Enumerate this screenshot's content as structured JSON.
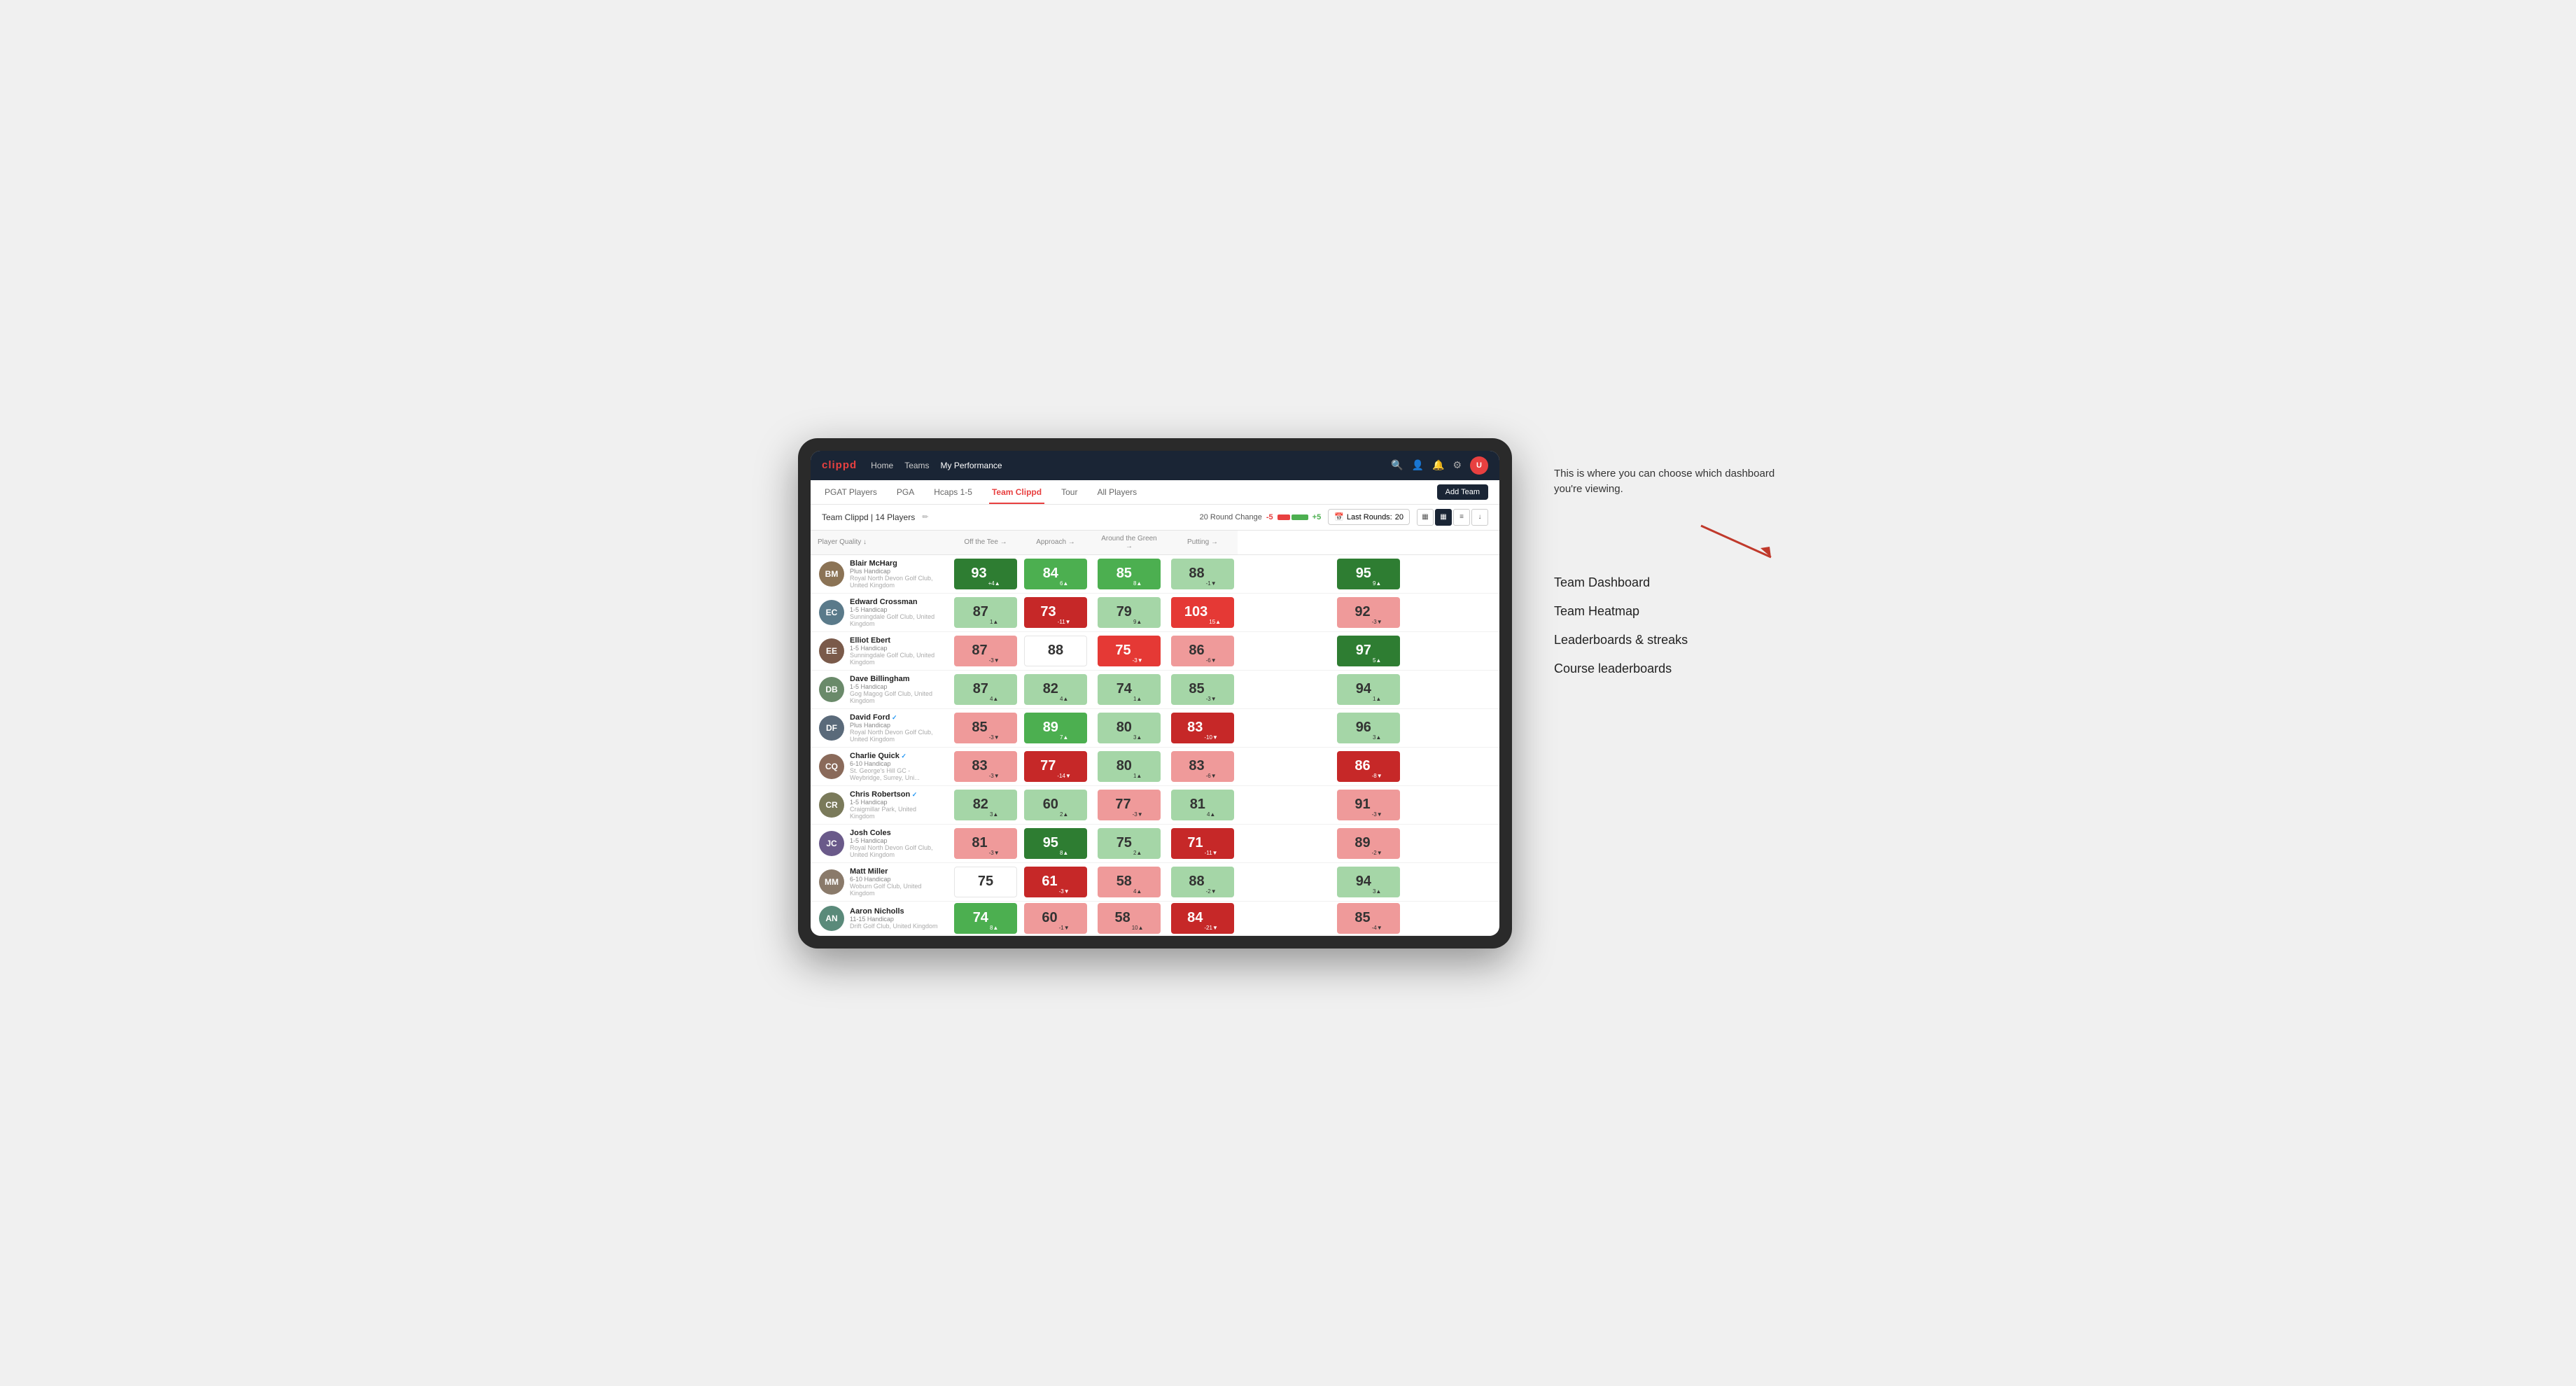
{
  "annotation": {
    "text": "This is where you can choose which dashboard you're viewing.",
    "arrow": "→"
  },
  "dashboard_options": [
    "Team Dashboard",
    "Team Heatmap",
    "Leaderboards & streaks",
    "Course leaderboards"
  ],
  "nav": {
    "logo": "clippd",
    "links": [
      "Home",
      "Teams",
      "My Performance"
    ],
    "active_link": "My Performance"
  },
  "tabs": [
    {
      "label": "PGAT Players"
    },
    {
      "label": "PGA"
    },
    {
      "label": "Hcaps 1-5"
    },
    {
      "label": "Team Clippd",
      "active": true
    },
    {
      "label": "Tour"
    },
    {
      "label": "All Players"
    }
  ],
  "add_team_label": "Add Team",
  "toolbar": {
    "team_label": "Team Clippd",
    "player_count": "14 Players",
    "round_change_label": "20 Round Change",
    "minus5": "-5",
    "plus5": "+5",
    "last_rounds_label": "Last Rounds:",
    "last_rounds_count": "20"
  },
  "table": {
    "headers": [
      "Player Quality ↓",
      "Off the Tee →",
      "Approach →",
      "Around the Green →",
      "Putting →"
    ],
    "rows": [
      {
        "name": "Blair McHarg",
        "handicap": "Plus Handicap",
        "club": "Royal North Devon Golf Club, United Kingdom",
        "avatar_color": "#8B7355",
        "scores": [
          {
            "value": 93,
            "change": "+4",
            "direction": "up",
            "color": "green-strong"
          },
          {
            "value": 84,
            "change": "6",
            "direction": "up",
            "color": "green-med"
          },
          {
            "value": 85,
            "change": "8",
            "direction": "up",
            "color": "green-med"
          },
          {
            "value": 88,
            "change": "-1",
            "direction": "down",
            "color": "green-light"
          },
          {
            "value": 95,
            "change": "9",
            "direction": "up",
            "color": "green-strong"
          }
        ]
      },
      {
        "name": "Edward Crossman",
        "handicap": "1-5 Handicap",
        "club": "Sunningdale Golf Club, United Kingdom",
        "avatar_color": "#5a7a8a",
        "scores": [
          {
            "value": 87,
            "change": "1",
            "direction": "up",
            "color": "green-light"
          },
          {
            "value": 73,
            "change": "-11",
            "direction": "down",
            "color": "red-strong"
          },
          {
            "value": 79,
            "change": "9",
            "direction": "up",
            "color": "green-light"
          },
          {
            "value": 103,
            "change": "15",
            "direction": "up",
            "color": "red-med"
          },
          {
            "value": 92,
            "change": "-3",
            "direction": "down",
            "color": "red-light"
          }
        ]
      },
      {
        "name": "Elliot Ebert",
        "handicap": "1-5 Handicap",
        "club": "Sunningdale Golf Club, United Kingdom",
        "avatar_color": "#7a5a4a",
        "scores": [
          {
            "value": 87,
            "change": "-3",
            "direction": "down",
            "color": "red-light"
          },
          {
            "value": 88,
            "change": "",
            "direction": "",
            "color": "neutral"
          },
          {
            "value": 75,
            "change": "-3",
            "direction": "down",
            "color": "red-med"
          },
          {
            "value": 86,
            "change": "-6",
            "direction": "down",
            "color": "red-light"
          },
          {
            "value": 97,
            "change": "5",
            "direction": "up",
            "color": "green-strong"
          }
        ]
      },
      {
        "name": "Dave Billingham",
        "handicap": "1-5 Handicap",
        "club": "Gog Magog Golf Club, United Kingdom",
        "avatar_color": "#6a8a6a",
        "scores": [
          {
            "value": 87,
            "change": "4",
            "direction": "up",
            "color": "green-light"
          },
          {
            "value": 82,
            "change": "4",
            "direction": "up",
            "color": "green-light"
          },
          {
            "value": 74,
            "change": "1",
            "direction": "up",
            "color": "green-light"
          },
          {
            "value": 85,
            "change": "-3",
            "direction": "down",
            "color": "green-light"
          },
          {
            "value": 94,
            "change": "1",
            "direction": "up",
            "color": "green-light"
          }
        ]
      },
      {
        "name": "David Ford",
        "handicap": "Plus Handicap",
        "club": "Royal North Devon Golf Club, United Kingdom",
        "avatar_color": "#5a6a7a",
        "verified": true,
        "scores": [
          {
            "value": 85,
            "change": "-3",
            "direction": "down",
            "color": "red-light"
          },
          {
            "value": 89,
            "change": "7",
            "direction": "up",
            "color": "green-med"
          },
          {
            "value": 80,
            "change": "3",
            "direction": "up",
            "color": "green-light"
          },
          {
            "value": 83,
            "change": "-10",
            "direction": "down",
            "color": "red-strong"
          },
          {
            "value": 96,
            "change": "3",
            "direction": "up",
            "color": "green-light"
          }
        ]
      },
      {
        "name": "Charlie Quick",
        "handicap": "6-10 Handicap",
        "club": "St. George's Hill GC - Weybridge, Surrey, Uni...",
        "avatar_color": "#8a6a5a",
        "verified": true,
        "scores": [
          {
            "value": 83,
            "change": "-3",
            "direction": "down",
            "color": "red-light"
          },
          {
            "value": 77,
            "change": "-14",
            "direction": "down",
            "color": "red-strong"
          },
          {
            "value": 80,
            "change": "1",
            "direction": "up",
            "color": "green-light"
          },
          {
            "value": 83,
            "change": "-6",
            "direction": "down",
            "color": "red-light"
          },
          {
            "value": 86,
            "change": "-8",
            "direction": "down",
            "color": "red-strong"
          }
        ]
      },
      {
        "name": "Chris Robertson",
        "handicap": "1-5 Handicap",
        "club": "Craigmillar Park, United Kingdom",
        "avatar_color": "#7a7a5a",
        "verified": true,
        "scores": [
          {
            "value": 82,
            "change": "3",
            "direction": "up",
            "color": "green-light"
          },
          {
            "value": 60,
            "change": "2",
            "direction": "up",
            "color": "green-light"
          },
          {
            "value": 77,
            "change": "-3",
            "direction": "down",
            "color": "red-light"
          },
          {
            "value": 81,
            "change": "4",
            "direction": "up",
            "color": "green-light"
          },
          {
            "value": 91,
            "change": "-3",
            "direction": "down",
            "color": "red-light"
          }
        ]
      },
      {
        "name": "Josh Coles",
        "handicap": "1-5 Handicap",
        "club": "Royal North Devon Golf Club, United Kingdom",
        "avatar_color": "#6a5a8a",
        "scores": [
          {
            "value": 81,
            "change": "-3",
            "direction": "down",
            "color": "red-light"
          },
          {
            "value": 95,
            "change": "8",
            "direction": "up",
            "color": "green-strong"
          },
          {
            "value": 75,
            "change": "2",
            "direction": "up",
            "color": "green-light"
          },
          {
            "value": 71,
            "change": "-11",
            "direction": "down",
            "color": "red-strong"
          },
          {
            "value": 89,
            "change": "-2",
            "direction": "down",
            "color": "red-light"
          }
        ]
      },
      {
        "name": "Matt Miller",
        "handicap": "6-10 Handicap",
        "club": "Woburn Golf Club, United Kingdom",
        "avatar_color": "#8a7a6a",
        "scores": [
          {
            "value": 75,
            "change": "",
            "direction": "",
            "color": "neutral"
          },
          {
            "value": 61,
            "change": "-3",
            "direction": "down",
            "color": "red-strong"
          },
          {
            "value": 58,
            "change": "4",
            "direction": "up",
            "color": "red-light"
          },
          {
            "value": 88,
            "change": "-2",
            "direction": "down",
            "color": "green-light"
          },
          {
            "value": 94,
            "change": "3",
            "direction": "up",
            "color": "green-light"
          }
        ]
      },
      {
        "name": "Aaron Nicholls",
        "handicap": "11-15 Handicap",
        "club": "Drift Golf Club, United Kingdom",
        "avatar_color": "#5a8a7a",
        "scores": [
          {
            "value": 74,
            "change": "8",
            "direction": "up",
            "color": "green-med"
          },
          {
            "value": 60,
            "change": "-1",
            "direction": "down",
            "color": "red-light"
          },
          {
            "value": 58,
            "change": "10",
            "direction": "up",
            "color": "red-light"
          },
          {
            "value": 84,
            "change": "-21",
            "direction": "down",
            "color": "red-strong"
          },
          {
            "value": 85,
            "change": "-4",
            "direction": "down",
            "color": "red-light"
          }
        ]
      }
    ]
  }
}
